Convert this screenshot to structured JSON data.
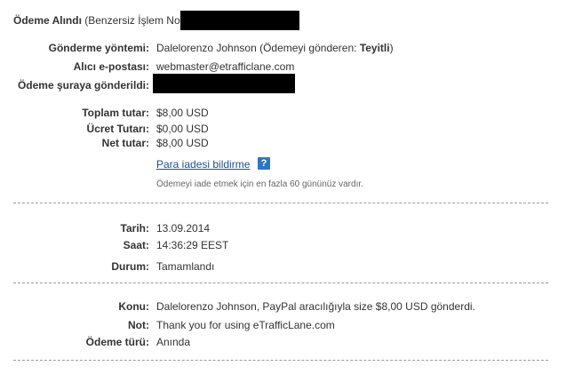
{
  "header": {
    "title_bold": "Ödeme Alındı",
    "title_rest": "(Benzersiz İşlem No"
  },
  "details": {
    "method_label": "Gönderme yöntemi:",
    "method_value": "Dalelorenzo Johnson (Ödemeyi gönderen:",
    "method_status": "Teyitli",
    "method_close": ")",
    "email_label": "Alıcı e-postası:",
    "email_value": "webmaster@etrafficlane.com",
    "sent_to_label": "Ödeme şuraya gönderildi:"
  },
  "amounts": {
    "total_label": "Toplam tutar:",
    "total_value": "$8,00 USD",
    "fee_label": "Ücret Tutarı:",
    "fee_value": "$0,00 USD",
    "net_label": "Net tutar:",
    "net_value": "$8,00 USD",
    "refund_link": "Para iadesi bildirme",
    "help_glyph": "?",
    "refund_note": "Ödemeyi iade etmek için en fazla 60 gününüz vardır."
  },
  "status": {
    "date_label": "Tarih:",
    "date_value": "13.09.2014",
    "time_label": "Saat:",
    "time_value": "14:36:29 EEST",
    "state_label": "Durum:",
    "state_value": "Tamamlandı"
  },
  "message": {
    "subject_label": "Konu:",
    "subject_value": "Dalelorenzo Johnson, PayPal aracılığıyla size $8,00 USD gönderdi.",
    "note_label": "Not:",
    "note_value": "Thank you for using eTrafficLane.com",
    "type_label": "Ödeme türü:",
    "type_value": "Anında"
  },
  "icons": {
    "help": "help-icon"
  }
}
